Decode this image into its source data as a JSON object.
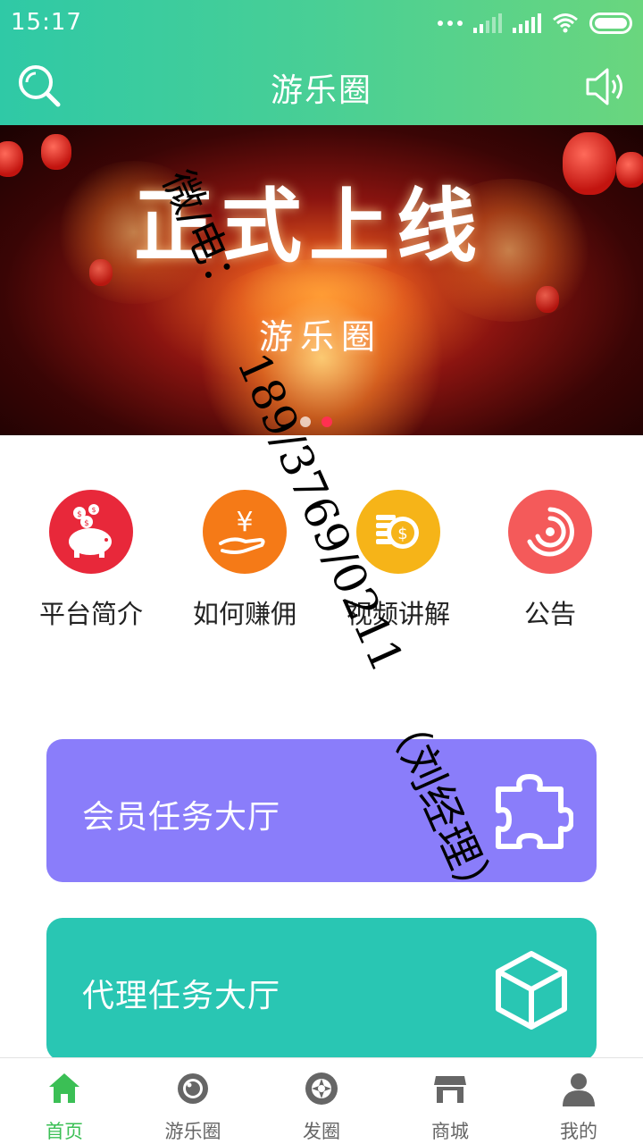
{
  "status_bar": {
    "time": "15:17"
  },
  "header": {
    "title": "游乐圈"
  },
  "banner": {
    "title": "正式上线",
    "subtitle": "游乐圈",
    "slide_count": 2,
    "active_slide": 2
  },
  "quick_menu": [
    {
      "label": "平台简介",
      "icon": "piggy-bank-icon",
      "color": "#e8283a"
    },
    {
      "label": "如何赚佣",
      "icon": "yen-hand-icon",
      "color": "#f57a17"
    },
    {
      "label": "视频讲解",
      "icon": "coins-icon",
      "color": "#f6b418"
    },
    {
      "label": "公告",
      "icon": "target-icon",
      "color": "#f45a5a"
    }
  ],
  "tasks": {
    "member": {
      "label": "会员任务大厅",
      "icon": "puzzle-icon",
      "color": "#8a7dfa"
    },
    "agent": {
      "label": "代理任务大厅",
      "icon": "cube-icon",
      "color": "#29c6b3"
    }
  },
  "watermark": {
    "line1": "微/电：",
    "line2": "189/3769/0211",
    "line3": "（刘经理）"
  },
  "tabs": [
    {
      "label": "首页",
      "icon": "home-icon",
      "active": true
    },
    {
      "label": "游乐圈",
      "icon": "camera-lens-icon",
      "active": false
    },
    {
      "label": "发圈",
      "icon": "aperture-icon",
      "active": false
    },
    {
      "label": "商城",
      "icon": "store-icon",
      "active": false
    },
    {
      "label": "我的",
      "icon": "user-icon",
      "active": false
    }
  ],
  "colors": {
    "accent": "#3bbf55",
    "header_start": "#2fc9a6",
    "header_end": "#6ad67e"
  }
}
